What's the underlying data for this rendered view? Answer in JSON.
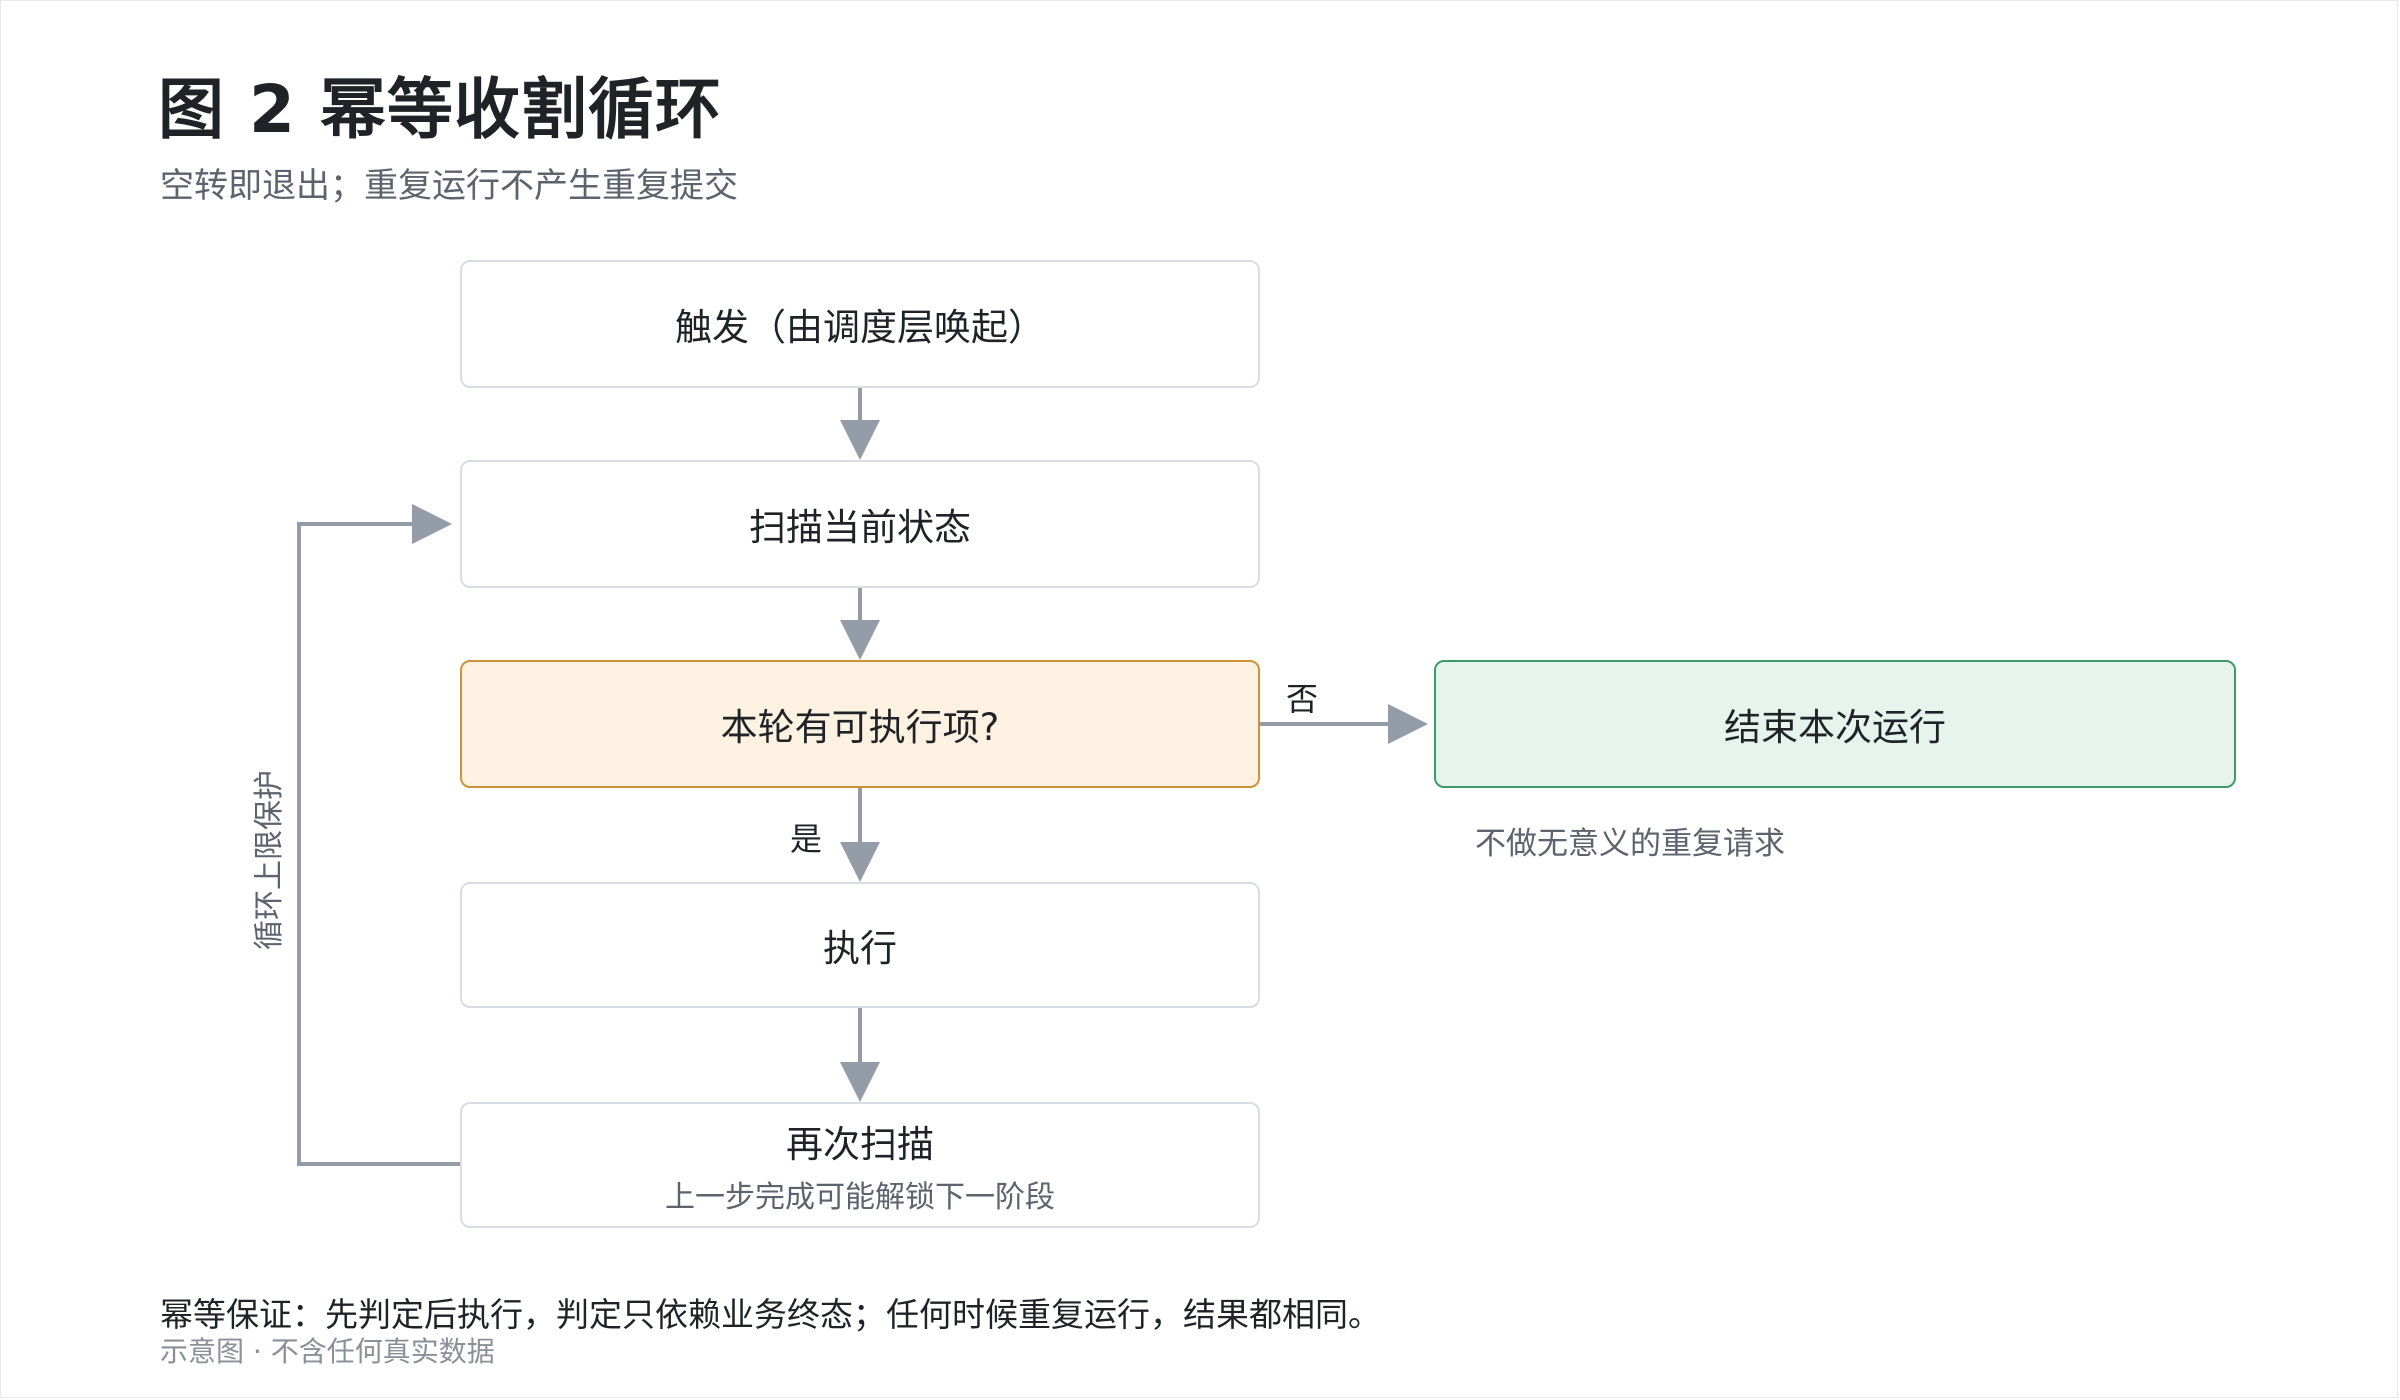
{
  "figure": {
    "title": "图 2    幂等收割循环",
    "subtitle": "空转即退出；重复运行不产生重复提交"
  },
  "flow": {
    "trigger": {
      "label": "触发（由调度层唤起）"
    },
    "scan": {
      "label": "扫描当前状态"
    },
    "decision": {
      "label": "本轮有可执行项?"
    },
    "execute": {
      "label": "执行"
    },
    "rescan": {
      "label": "再次扫描",
      "sub": "上一步完成可能解锁下一阶段"
    },
    "end": {
      "label": "结束本次运行",
      "note": "不做无意义的重复请求"
    },
    "edge_yes": "是",
    "edge_no": "否",
    "loop_label": "循环上限保护"
  },
  "footer": {
    "guarantee": "幂等保证：先判定后执行，判定只依赖业务终态；任何时候重复运行，结果都相同。",
    "disclaimer": "示意图 · 不含任何真实数据"
  },
  "colors": {
    "connector": "#949ca8",
    "decision_fill": "#fdf2e1",
    "decision_border": "#d0923a",
    "end_fill": "#e6f4ec",
    "end_border": "#3e9a6c",
    "box_border": "#d9dde2"
  }
}
